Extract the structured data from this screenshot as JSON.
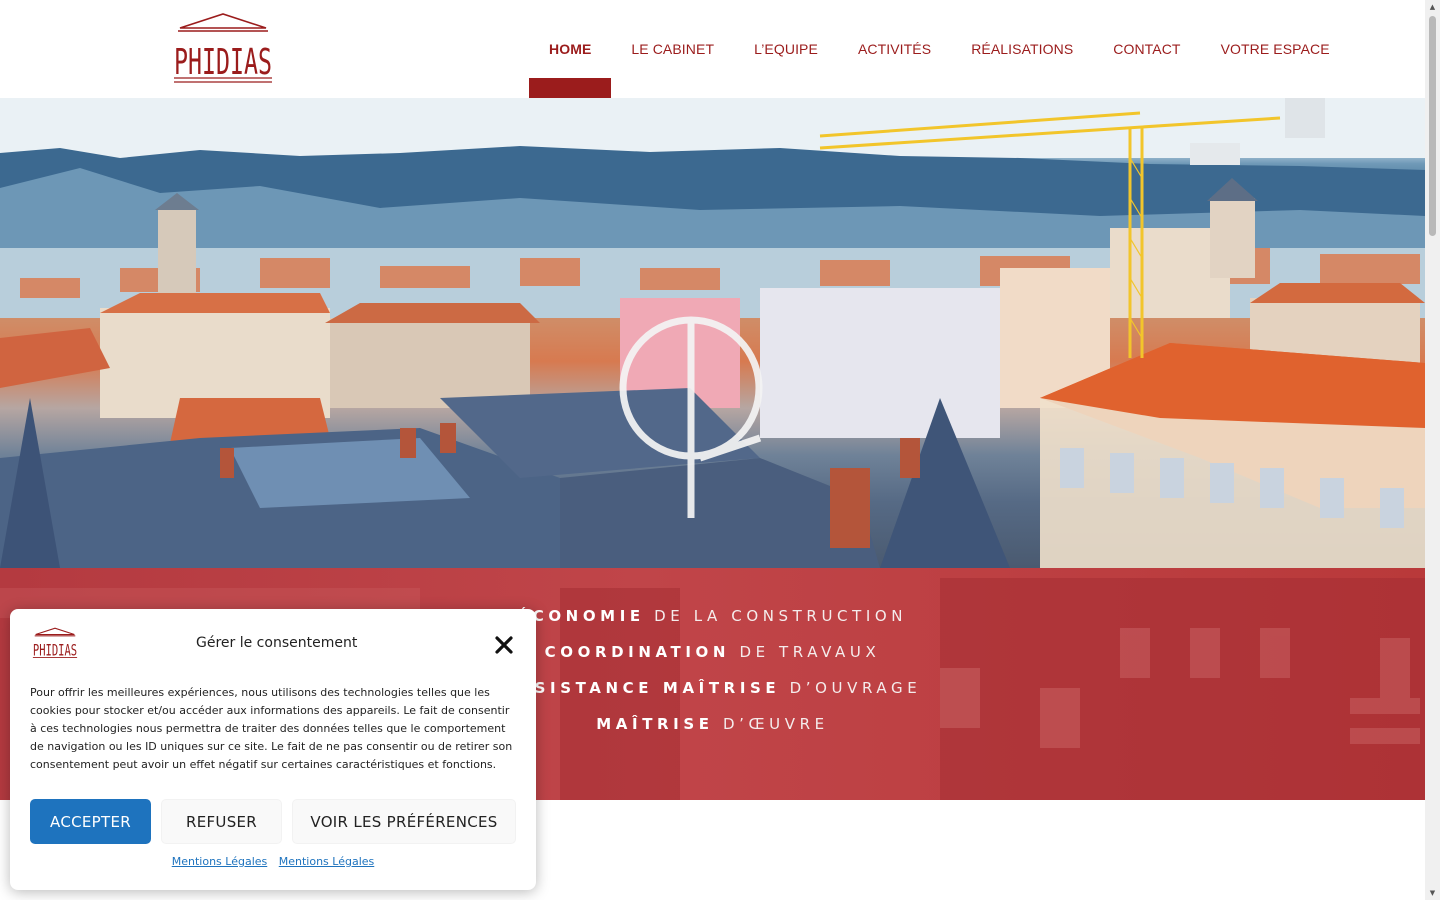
{
  "brand": {
    "logo_text": "PHIDIAS",
    "color": "#9b1c1c"
  },
  "nav": {
    "items": [
      {
        "label": "HOME",
        "active": true
      },
      {
        "label": "LE CABINET"
      },
      {
        "label": "L’EQUIPE"
      },
      {
        "label": "ACTIVITÉS"
      },
      {
        "label": "RÉALISATIONS"
      },
      {
        "label": "CONTACT"
      },
      {
        "label": "VOTRE ESPACE"
      }
    ]
  },
  "hero": {
    "image": "city-rooftops-with-crane",
    "emblem_icon": "phidias-emblem-icon"
  },
  "services": [
    {
      "bold": "ÉCONOMIE",
      "rest": " DE LA CONSTRUCTION"
    },
    {
      "bold": "COORDINATION",
      "rest": " DE TRAVAUX"
    },
    {
      "bold": "ASSISTANCE MAÎTRISE",
      "rest": " D’OUVRAGE"
    },
    {
      "bold": "MAÎTRISE",
      "rest": " D’ŒUVRE"
    }
  ],
  "consent": {
    "title": "Gérer le consentement",
    "text": "Pour offrir les meilleures expériences, nous utilisons des technologies telles que les cookies pour stocker et/ou accéder aux informations des appareils. Le fait de consentir à ces technologies nous permettra de traiter des données telles que le comportement de navigation ou les ID uniques sur ce site. Le fait de ne pas consentir ou de retirer son consentement peut avoir un effet négatif sur certaines caractéristiques et fonctions.",
    "accept_label": "ACCEPTER",
    "refuse_label": "REFUSER",
    "prefs_label": "VOIR LES PRÉFÉRENCES",
    "links": [
      "Mentions Légales",
      "Mentions Légales"
    ],
    "accent_color": "#1e73be"
  },
  "colors": {
    "primary": "#9b1c1c",
    "band": "#b9393a"
  }
}
